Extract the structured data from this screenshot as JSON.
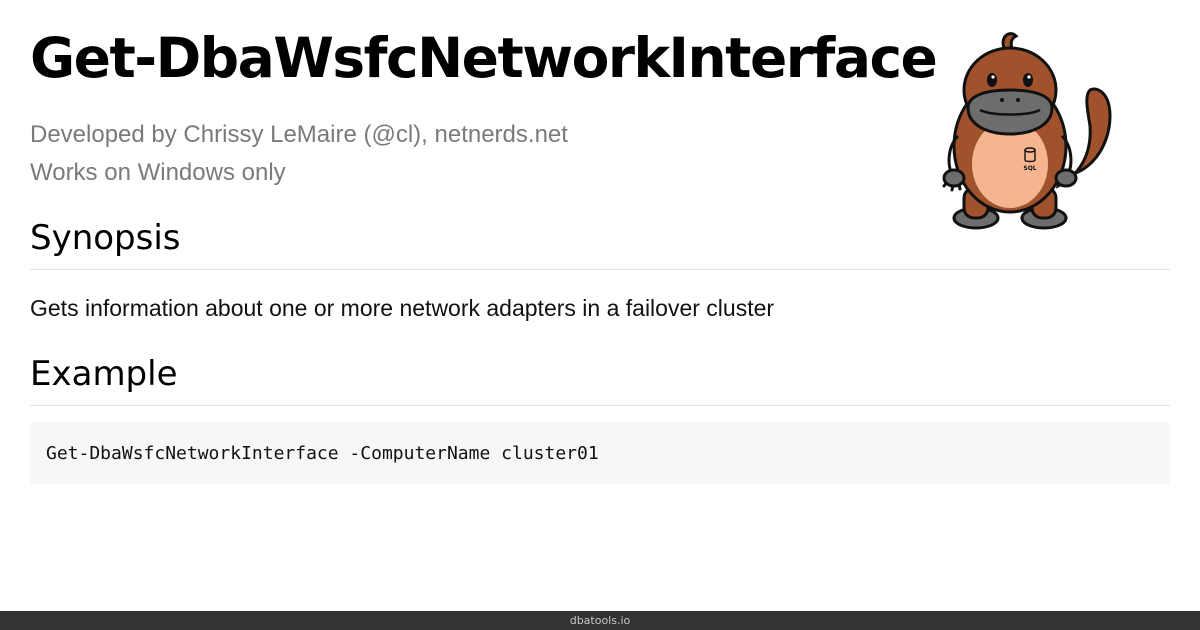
{
  "command": {
    "title": "Get-DbaWsfcNetworkInterface",
    "developer": "Developed by Chrissy LeMaire (@cl), netnerds.net",
    "platform": "Works on Windows only"
  },
  "synopsis": {
    "heading": "Synopsis",
    "text": "Gets information about one or more network adapters in a failover cluster"
  },
  "example": {
    "heading": "Example",
    "code": "Get-DbaWsfcNetworkInterface -ComputerName cluster01"
  },
  "mascot": {
    "icon": "platypus-mascot-icon",
    "badge_text": "SQL",
    "colors": {
      "body": "#a0522d",
      "belly": "#f5b58e",
      "bill": "#6d6d6d",
      "outline": "#111111"
    }
  },
  "footer": {
    "site": "dbatools.io"
  }
}
